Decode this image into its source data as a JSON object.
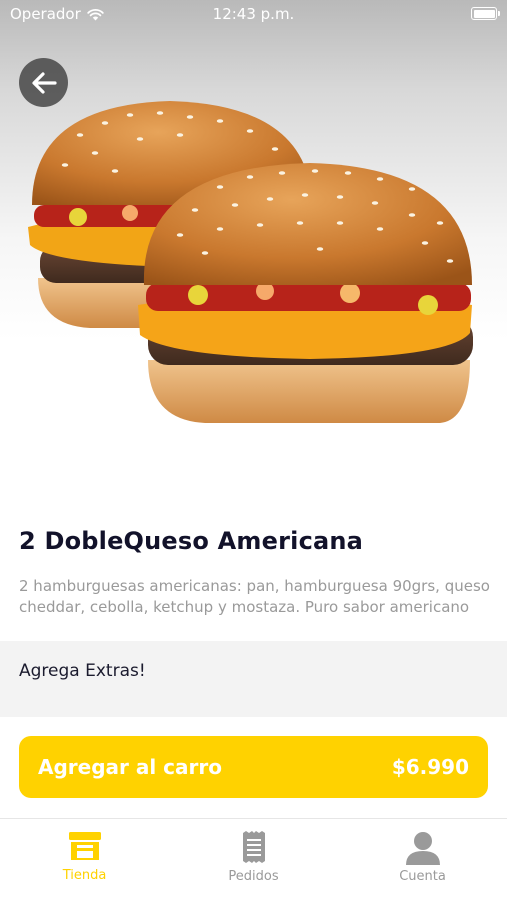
{
  "status_bar": {
    "carrier": "Operador",
    "time": "12:43 p.m."
  },
  "icons": {
    "back": "arrow-left-icon",
    "wifi": "wifi-icon",
    "battery": "battery-icon",
    "store": "store-icon",
    "orders": "receipt-icon",
    "account": "user-icon"
  },
  "product": {
    "image_alt": "burger",
    "title": "2 DobleQueso Americana",
    "description": "2 hamburguesas americanas: pan, hamburguesa 90grs, queso cheddar, cebolla, ketchup y mostaza. Puro sabor americano"
  },
  "extras": {
    "label": "Agrega Extras!"
  },
  "cta": {
    "label": "Agregar al carro",
    "price": "$6.990"
  },
  "tabs": [
    {
      "label": "Tienda",
      "active": true
    },
    {
      "label": "Pedidos",
      "active": false
    },
    {
      "label": "Cuenta",
      "active": false
    }
  ],
  "colors": {
    "accent": "#ffd200",
    "title": "#12122a",
    "muted": "#9a9a9a",
    "extras_bg": "#f3f3f3"
  }
}
